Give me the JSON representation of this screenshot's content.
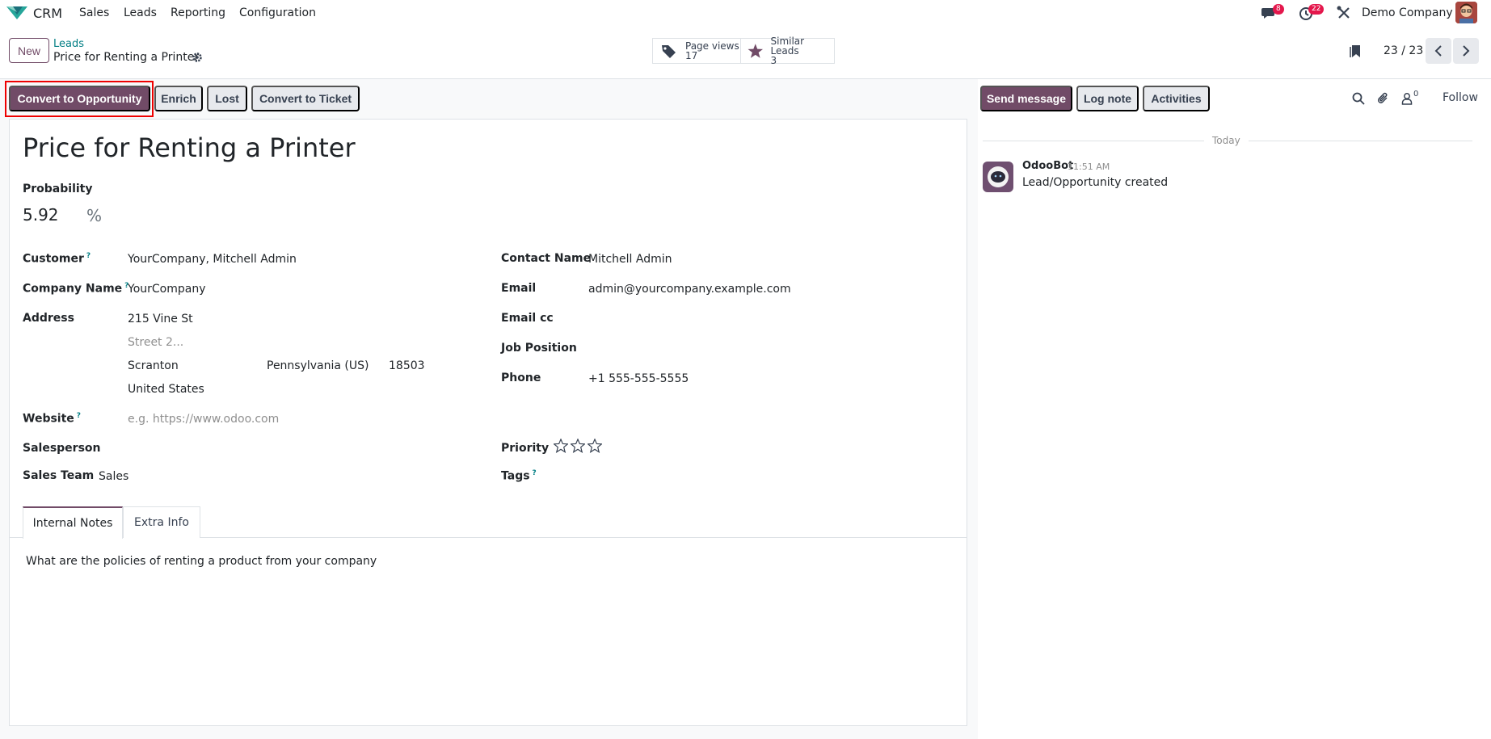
{
  "navbar": {
    "app_name": "CRM",
    "menus": [
      "Sales",
      "Leads",
      "Reporting",
      "Configuration"
    ],
    "messages_badge": "8",
    "activities_badge": "22",
    "company": "Demo Company"
  },
  "control_panel": {
    "new_label": "New",
    "breadcrumb_parent": "Leads",
    "breadcrumb_current": "Price for Renting a Printer",
    "stats": [
      {
        "label": "Page views",
        "value": "17",
        "icon": "tags-icon"
      },
      {
        "label": "Similar Leads",
        "value": "3",
        "icon": "star-icon"
      }
    ],
    "pager": "23 / 23"
  },
  "statusbar": {
    "buttons": [
      "Convert to Opportunity",
      "Enrich",
      "Lost",
      "Convert to Ticket"
    ]
  },
  "form": {
    "title": "Price for Renting a Printer",
    "probability_label": "Probability",
    "probability_value": "5.92",
    "probability_unit": "%",
    "left": {
      "customer_label": "Customer",
      "customer_value": "YourCompany, Mitchell Admin",
      "company_label": "Company Name",
      "company_value": "YourCompany",
      "address_label": "Address",
      "street": "215 Vine St",
      "street2_placeholder": "Street 2...",
      "city": "Scranton",
      "state": "Pennsylvania (US)",
      "zip": "18503",
      "country": "United States",
      "website_label": "Website",
      "website_placeholder": "e.g. https://www.odoo.com",
      "salesperson_label": "Salesperson",
      "team_label": "Sales Team",
      "team_value": "Sales"
    },
    "right": {
      "contact_label": "Contact Name",
      "contact_value": "Mitchell Admin",
      "email_label": "Email",
      "email_value": "admin@yourcompany.example.com",
      "emailcc_label": "Email cc",
      "job_label": "Job Position",
      "phone_label": "Phone",
      "phone_value": "+1 555-555-5555",
      "priority_label": "Priority",
      "priority_stars": 0,
      "priority_max": 3,
      "tags_label": "Tags"
    },
    "help_marker": "?",
    "tabs": [
      "Internal Notes",
      "Extra Info"
    ],
    "note": "What are the policies of renting a product from your company"
  },
  "chatter": {
    "send_message": "Send message",
    "log_note": "Log note",
    "activities": "Activities",
    "followers_count": "0",
    "follow": "Follow",
    "date_separator": "Today",
    "author": "OdooBot",
    "time": "11:51 AM",
    "message": "Lead/Opportunity created"
  },
  "colors": {
    "brand": "#714b67",
    "link": "#017e84",
    "badge": "#e4174c"
  }
}
